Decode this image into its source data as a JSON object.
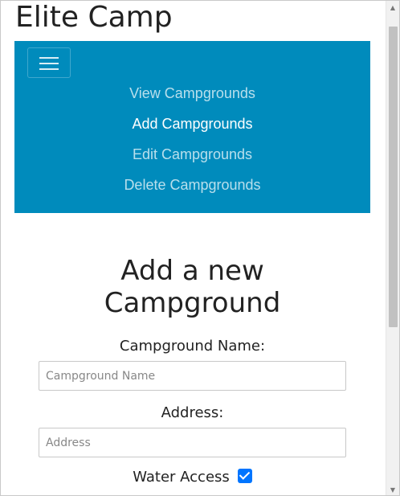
{
  "app": {
    "title": "Elite Camp"
  },
  "colors": {
    "nav_bg": "#008bbc",
    "accent": "#0075ff",
    "text": "#222222"
  },
  "nav": {
    "toggler_icon": "hamburger-icon",
    "items": [
      {
        "label": "View Campgrounds",
        "active": false
      },
      {
        "label": "Add Campgrounds",
        "active": true
      },
      {
        "label": "Edit Campgrounds",
        "active": false
      },
      {
        "label": "Delete Campgrounds",
        "active": false
      }
    ]
  },
  "form": {
    "heading_line1": "Add a new",
    "heading_line2": "Campground",
    "name_label": "Campground Name:",
    "name_placeholder": "Campground Name",
    "name_value": "",
    "address_label": "Address:",
    "address_placeholder": "Address",
    "address_value": "",
    "water_label": "Water Access",
    "water_checked": true
  },
  "scrollbar": {
    "up_icon": "scroll-up-arrow-icon",
    "down_icon": "scroll-down-arrow-icon"
  }
}
